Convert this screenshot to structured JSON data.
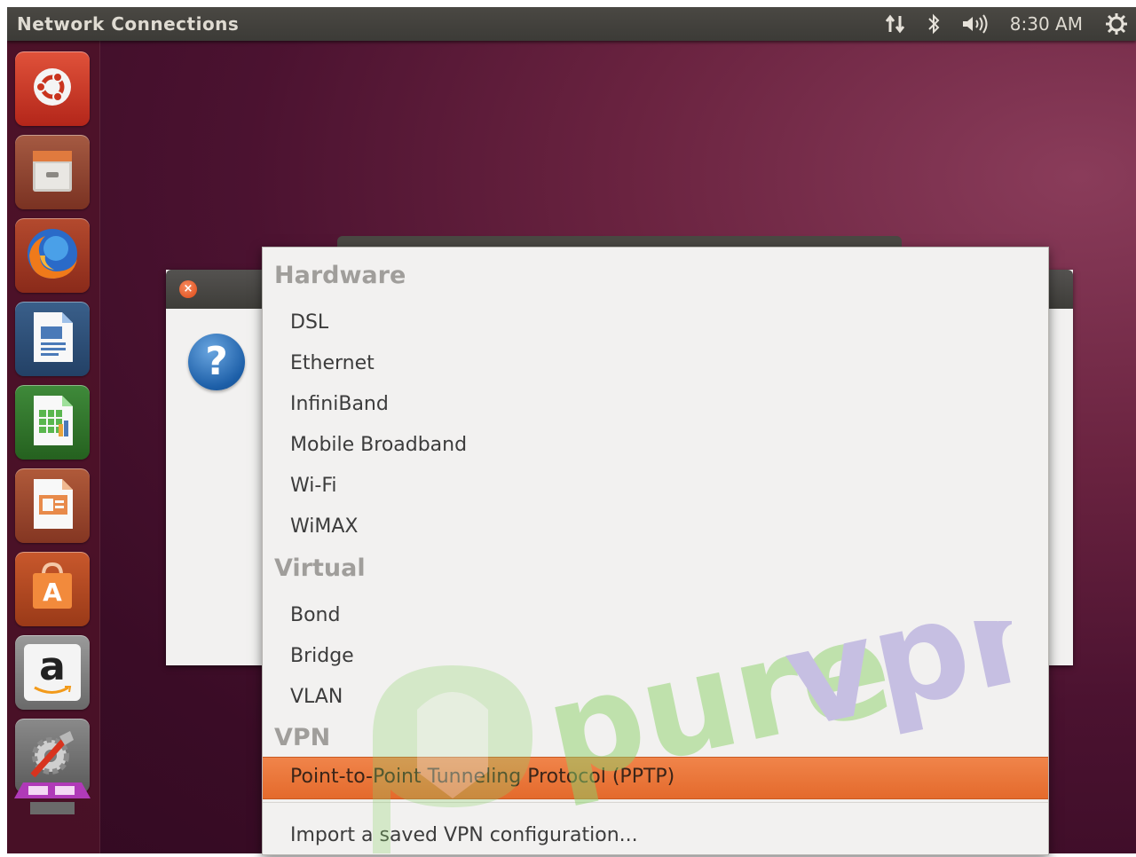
{
  "panel": {
    "title": "Network Connections",
    "clock": "8:30 AM",
    "indicators": [
      "network-icon",
      "bluetooth-icon",
      "volume-icon",
      "session-gear-icon"
    ]
  },
  "launcher": {
    "items": [
      {
        "name": "ubuntu-dash",
        "icon": "ubuntu-logo-icon"
      },
      {
        "name": "files",
        "icon": "file-cabinet-icon"
      },
      {
        "name": "firefox",
        "icon": "firefox-icon"
      },
      {
        "name": "libreoffice-writer",
        "icon": "writer-doc-icon"
      },
      {
        "name": "libreoffice-calc",
        "icon": "calc-sheet-icon"
      },
      {
        "name": "libreoffice-impress",
        "icon": "impress-slide-icon"
      },
      {
        "name": "ubuntu-software-center",
        "icon": "shopping-bag-icon"
      },
      {
        "name": "amazon",
        "icon": "amazon-icon"
      },
      {
        "name": "system-settings",
        "icon": "settings-tools-icon"
      },
      {
        "name": "workspaces",
        "icon": "workspace-switcher-icon"
      }
    ],
    "amazon_letter": "a"
  },
  "dialog": {
    "icon": "question-icon",
    "question_mark": "?",
    "close_symbol": "×"
  },
  "menu": {
    "sections": [
      {
        "label": "Hardware",
        "items": [
          "DSL",
          "Ethernet",
          "InfiniBand",
          "Mobile Broadband",
          "Wi-Fi",
          "WiMAX"
        ]
      },
      {
        "label": "Virtual",
        "items": [
          "Bond",
          "Bridge",
          "VLAN"
        ]
      },
      {
        "label": "VPN",
        "items": [
          "Point-to-Point Tunneling Protocol (PPTP)"
        ]
      }
    ],
    "highlighted_item": "Point-to-Point Tunneling Protocol (PPTP)",
    "import_item": "Import a saved VPN configuration..."
  },
  "watermark": {
    "text_pure": "pure",
    "text_vpn": "vpn"
  },
  "colors": {
    "highlight": "#e8743b",
    "section_label": "#a09e9b",
    "panel_bg": "#3c3b37",
    "watermark_green": "#8ed36b",
    "watermark_purple": "#9b8fd6"
  }
}
